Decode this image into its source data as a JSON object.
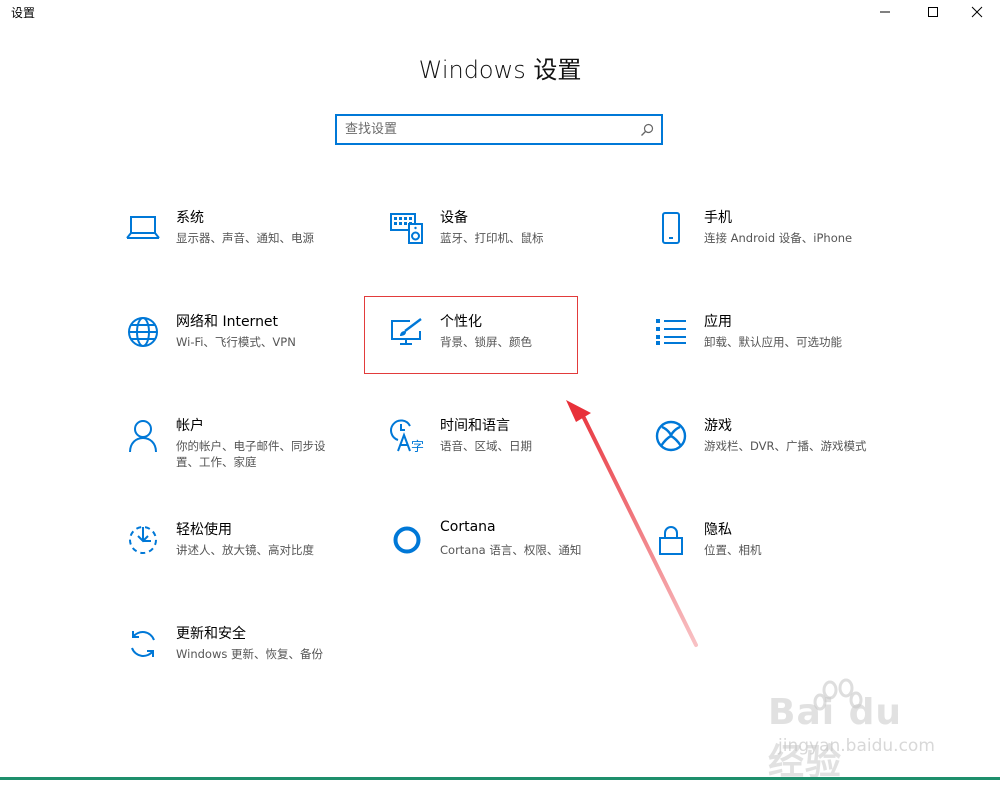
{
  "window": {
    "title": "设置",
    "controls": [
      "minimize-icon",
      "maximize-icon",
      "close-icon"
    ]
  },
  "header": {
    "title": "Windows 设置"
  },
  "search": {
    "placeholder": "查找设置",
    "value": ""
  },
  "tiles": [
    {
      "title": "系统",
      "desc": "显示器、声音、通知、电源",
      "icon": "laptop-icon"
    },
    {
      "title": "设备",
      "desc": "蓝牙、打印机、鼠标",
      "icon": "keyboard-speaker-icon"
    },
    {
      "title": "手机",
      "desc": "连接 Android 设备、iPhone",
      "icon": "phone-icon"
    },
    {
      "title": "网络和 Internet",
      "desc": "Wi-Fi、飞行模式、VPN",
      "icon": "globe-icon"
    },
    {
      "title": "个性化",
      "desc": "背景、锁屏、颜色",
      "icon": "paintbrush-monitor-icon"
    },
    {
      "title": "应用",
      "desc": "卸载、默认应用、可选功能",
      "icon": "apps-list-icon"
    },
    {
      "title": "帐户",
      "desc": "你的帐户、电子邮件、同步设置、工作、家庭",
      "icon": "person-icon"
    },
    {
      "title": "时间和语言",
      "desc": "语音、区域、日期",
      "icon": "clock-language-icon"
    },
    {
      "title": "游戏",
      "desc": "游戏栏、DVR、广播、游戏模式",
      "icon": "xbox-icon"
    },
    {
      "title": "轻松使用",
      "desc": "讲述人、放大镜、高对比度",
      "icon": "ease-of-access-icon"
    },
    {
      "title": "Cortana",
      "desc": "Cortana 语言、权限、通知",
      "icon": "cortana-icon"
    },
    {
      "title": "隐私",
      "desc": "位置、相机",
      "icon": "lock-icon"
    },
    {
      "title": "更新和安全",
      "desc": "Windows 更新、恢复、备份",
      "icon": "sync-icon"
    }
  ],
  "watermark": {
    "brand": "Bai du 经验",
    "url": "jingyan.baidu.com"
  },
  "colors": {
    "accent": "#0078d7",
    "highlight": "#e23b3b",
    "arrow": "#e8313a"
  }
}
